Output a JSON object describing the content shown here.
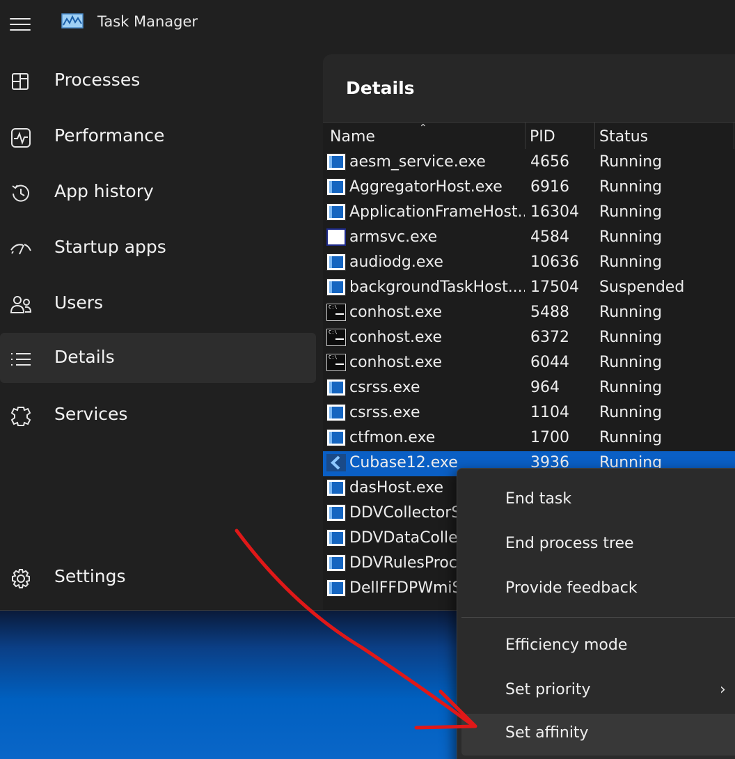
{
  "app": {
    "title": "Task Manager"
  },
  "sidebar": {
    "items": [
      {
        "label": "Processes",
        "icon": "processes-icon"
      },
      {
        "label": "Performance",
        "icon": "performance-icon"
      },
      {
        "label": "App history",
        "icon": "app-history-icon"
      },
      {
        "label": "Startup apps",
        "icon": "startup-apps-icon"
      },
      {
        "label": "Users",
        "icon": "users-icon"
      },
      {
        "label": "Details",
        "icon": "details-icon",
        "active": true
      },
      {
        "label": "Services",
        "icon": "services-icon"
      }
    ],
    "settings_label": "Settings"
  },
  "details": {
    "title": "Details",
    "columns": {
      "name": "Name",
      "pid": "PID",
      "status": "Status"
    },
    "rows": [
      {
        "name": "aesm_service.exe",
        "pid": "4656",
        "status": "Running",
        "icon": "app"
      },
      {
        "name": "AggregatorHost.exe",
        "pid": "6916",
        "status": "Running",
        "icon": "app"
      },
      {
        "name": "ApplicationFrameHost...",
        "pid": "16304",
        "status": "Running",
        "icon": "app"
      },
      {
        "name": "armsvc.exe",
        "pid": "4584",
        "status": "Running",
        "icon": "white"
      },
      {
        "name": "audiodg.exe",
        "pid": "10636",
        "status": "Running",
        "icon": "app"
      },
      {
        "name": "backgroundTaskHost....",
        "pid": "17504",
        "status": "Suspended",
        "icon": "app"
      },
      {
        "name": "conhost.exe",
        "pid": "5488",
        "status": "Running",
        "icon": "cmd"
      },
      {
        "name": "conhost.exe",
        "pid": "6372",
        "status": "Running",
        "icon": "cmd"
      },
      {
        "name": "conhost.exe",
        "pid": "6044",
        "status": "Running",
        "icon": "cmd"
      },
      {
        "name": "csrss.exe",
        "pid": "964",
        "status": "Running",
        "icon": "app"
      },
      {
        "name": "csrss.exe",
        "pid": "1104",
        "status": "Running",
        "icon": "app"
      },
      {
        "name": "ctfmon.exe",
        "pid": "1700",
        "status": "Running",
        "icon": "app"
      },
      {
        "name": "Cubase12.exe",
        "pid": "3936",
        "status": "Running",
        "icon": "cubase",
        "selected": true
      },
      {
        "name": "dasHost.exe",
        "pid": "",
        "status": "",
        "icon": "app"
      },
      {
        "name": "DDVCollectorS",
        "pid": "",
        "status": "",
        "icon": "app"
      },
      {
        "name": "DDVDataColle",
        "pid": "",
        "status": "",
        "icon": "app"
      },
      {
        "name": "DDVRulesProc",
        "pid": "",
        "status": "",
        "icon": "app"
      },
      {
        "name": "DellFFDPWmiS",
        "pid": "",
        "status": "",
        "icon": "app"
      }
    ]
  },
  "context_menu": {
    "items": [
      {
        "label": "End task"
      },
      {
        "label": "End process tree"
      },
      {
        "label": "Provide feedback"
      },
      {
        "label": "Efficiency mode"
      },
      {
        "label": "Set priority",
        "submenu": true
      },
      {
        "label": "Set affinity",
        "highlighted": true
      }
    ]
  },
  "colors": {
    "background": "#202020",
    "selection": "#0a5fc5",
    "annotation_arrow": "#e01818"
  }
}
